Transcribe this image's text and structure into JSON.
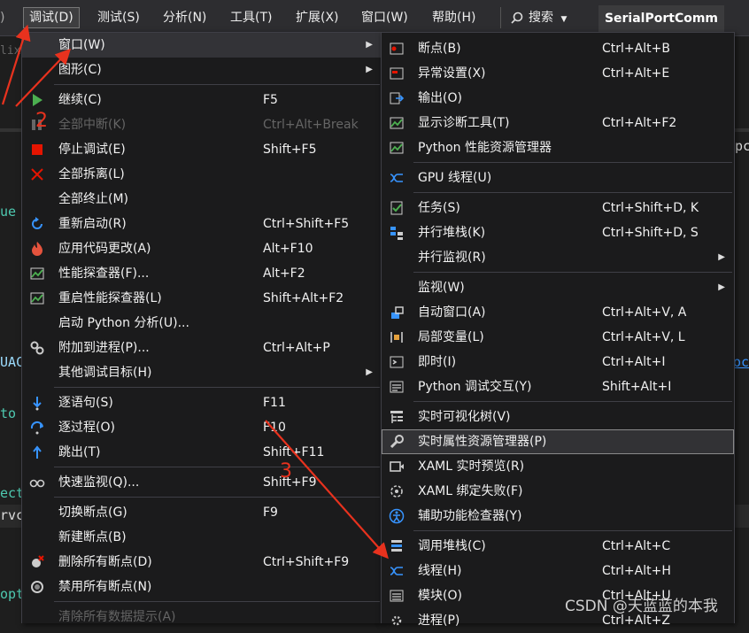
{
  "menubar": {
    "items": [
      {
        "label": "调试(D)"
      },
      {
        "label": "测试(S)"
      },
      {
        "label": "分析(N)"
      },
      {
        "label": "工具(T)"
      },
      {
        "label": "扩展(X)"
      },
      {
        "label": "窗口(W)"
      },
      {
        "label": "帮助(H)"
      }
    ],
    "search": "搜索",
    "project": "SerialPortComm"
  },
  "background_fragments": [
    "lixe",
    "ue",
    "UAC",
    "to",
    "ect",
    "rvc",
    "opt",
    "pc",
    "oc"
  ],
  "debug_menu": {
    "items": [
      {
        "label": "窗口(W)",
        "submenu": true,
        "highlighted": true
      },
      {
        "label": "图形(C)",
        "submenu": true
      },
      {
        "label": "继续(C)",
        "shortcut": "F5",
        "icon": "play-icon"
      },
      {
        "label": "全部中断(K)",
        "shortcut": "Ctrl+Alt+Break",
        "disabled": true,
        "icon": "pause-icon"
      },
      {
        "label": "停止调试(E)",
        "shortcut": "Shift+F5",
        "icon": "stop-icon"
      },
      {
        "label": "全部拆离(L)",
        "icon": "detach-icon"
      },
      {
        "label": "全部终止(M)"
      },
      {
        "label": "重新启动(R)",
        "shortcut": "Ctrl+Shift+F5",
        "icon": "restart-icon"
      },
      {
        "label": "应用代码更改(A)",
        "shortcut": "Alt+F10",
        "icon": "hot-reload-icon"
      },
      {
        "label": "性能探查器(F)...",
        "shortcut": "Alt+F2",
        "icon": "profiler-icon"
      },
      {
        "label": "重启性能探查器(L)",
        "shortcut": "Shift+Alt+F2",
        "icon": "profiler-restart-icon"
      },
      {
        "label": "启动 Python 分析(U)..."
      },
      {
        "label": "附加到进程(P)...",
        "shortcut": "Ctrl+Alt+P",
        "icon": "attach-process-icon"
      },
      {
        "label": "其他调试目标(H)",
        "submenu": true
      },
      {
        "label": "逐语句(S)",
        "shortcut": "F11",
        "icon": "step-into-icon"
      },
      {
        "label": "逐过程(O)",
        "shortcut": "F10",
        "icon": "step-over-icon"
      },
      {
        "label": "跳出(T)",
        "shortcut": "Shift+F11",
        "icon": "step-out-icon"
      },
      {
        "label": "快速监视(Q)...",
        "shortcut": "Shift+F9",
        "icon": "quickwatch-icon"
      },
      {
        "label": "切换断点(G)",
        "shortcut": "F9"
      },
      {
        "label": "新建断点(B)"
      },
      {
        "label": "删除所有断点(D)",
        "shortcut": "Ctrl+Shift+F9",
        "icon": "delete-breakpoints-icon"
      },
      {
        "label": "禁用所有断点(N)",
        "icon": "disable-breakpoints-icon"
      },
      {
        "label": "清除所有数据提示(A)",
        "disabled": true
      }
    ]
  },
  "window_menu": {
    "items": [
      {
        "label": "断点(B)",
        "shortcut": "Ctrl+Alt+B",
        "icon": "breakpoints-window-icon"
      },
      {
        "label": "异常设置(X)",
        "shortcut": "Ctrl+Alt+E",
        "icon": "exception-settings-icon"
      },
      {
        "label": "输出(O)",
        "icon": "output-icon"
      },
      {
        "label": "显示诊断工具(T)",
        "shortcut": "Ctrl+Alt+F2",
        "icon": "diagnostic-tools-icon"
      },
      {
        "label": "Python 性能资源管理器",
        "icon": "python-perf-icon"
      },
      {
        "label": "GPU 线程(U)",
        "icon": "gpu-threads-icon"
      },
      {
        "label": "任务(S)",
        "shortcut": "Ctrl+Shift+D, K",
        "icon": "tasks-icon"
      },
      {
        "label": "并行堆栈(K)",
        "shortcut": "Ctrl+Shift+D, S",
        "icon": "parallel-stacks-icon"
      },
      {
        "label": "并行监视(R)",
        "submenu": true
      },
      {
        "label": "监视(W)",
        "submenu": true
      },
      {
        "label": "自动窗口(A)",
        "shortcut": "Ctrl+Alt+V, A",
        "icon": "autos-icon"
      },
      {
        "label": "局部变量(L)",
        "shortcut": "Ctrl+Alt+V, L",
        "icon": "locals-icon"
      },
      {
        "label": "即时(I)",
        "shortcut": "Ctrl+Alt+I",
        "icon": "immediate-icon"
      },
      {
        "label": "Python 调试交互(Y)",
        "shortcut": "Shift+Alt+I",
        "icon": "python-interactive-icon"
      },
      {
        "label": "实时可视化树(V)",
        "icon": "visual-tree-icon"
      },
      {
        "label": "实时属性资源管理器(P)",
        "icon": "property-explorer-icon",
        "selected": true
      },
      {
        "label": "XAML 实时预览(R)",
        "icon": "xaml-preview-icon"
      },
      {
        "label": "XAML 绑定失败(F)",
        "icon": "xaml-binding-icon"
      },
      {
        "label": "辅助功能检查器(Y)",
        "icon": "accessibility-icon"
      },
      {
        "label": "调用堆栈(C)",
        "shortcut": "Ctrl+Alt+C",
        "icon": "call-stack-icon"
      },
      {
        "label": "线程(H)",
        "shortcut": "Ctrl+Alt+H",
        "icon": "threads-icon"
      },
      {
        "label": "模块(O)",
        "shortcut": "Ctrl+Alt+U",
        "icon": "modules-icon"
      },
      {
        "label": "进程(P)",
        "shortcut": "Ctrl+Alt+Z",
        "icon": "processes-icon"
      }
    ]
  },
  "annotations": {
    "step2": "2",
    "step3": "3",
    "arrow_color": "#e8321e"
  },
  "watermark": "CSDN @天蓝蓝的本我",
  "colors": {
    "menu_bg": "#1b1b1c",
    "menubar_bg": "#2d2d30",
    "editor_bg": "#1e1e1e",
    "accent_blue": "#3794ff",
    "stop_red": "#e51400"
  }
}
